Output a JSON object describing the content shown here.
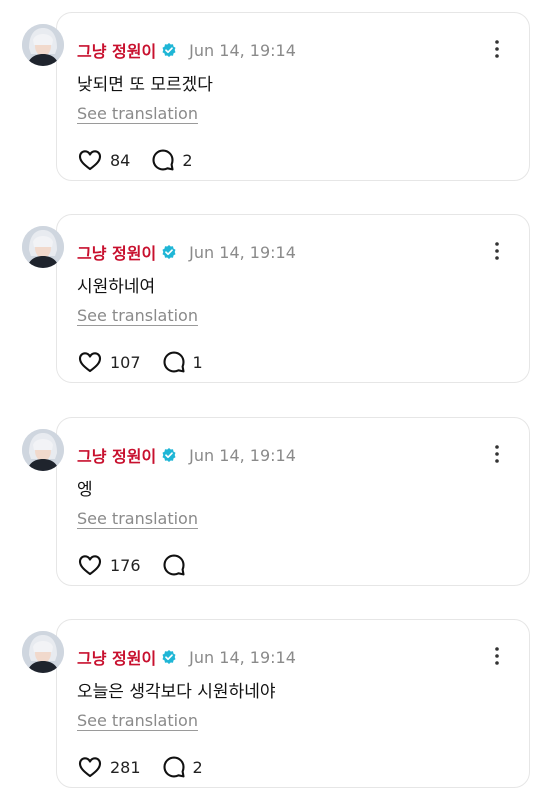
{
  "posts": [
    {
      "author": "그냥 정원이",
      "time": "Jun 14, 19:14",
      "text": "낮되면 또 모르겠다",
      "translate": "See translation",
      "likes": "84",
      "replies": "2"
    },
    {
      "author": "그냥 정원이",
      "time": "Jun 14, 19:14",
      "text": "시원하네여",
      "translate": "See translation",
      "likes": "107",
      "replies": "1"
    },
    {
      "author": "그냥 정원이",
      "time": "Jun 14, 19:14",
      "text": "엥",
      "translate": "See translation",
      "likes": "176",
      "replies": ""
    },
    {
      "author": "그냥 정원이",
      "time": "Jun 14, 19:14",
      "text": "오늘은 생각보다 시원하네야",
      "translate": "See translation",
      "likes": "281",
      "replies": "2"
    }
  ],
  "icons": {
    "verified": "verified-badge-icon",
    "more": "more-options-icon",
    "like": "heart-icon",
    "reply": "reply-bubble-icon"
  },
  "colors": {
    "author": "#c8102e",
    "verified": "#1fb6d6",
    "muted": "#8a8a8a",
    "card_border": "#e6e6e6"
  }
}
